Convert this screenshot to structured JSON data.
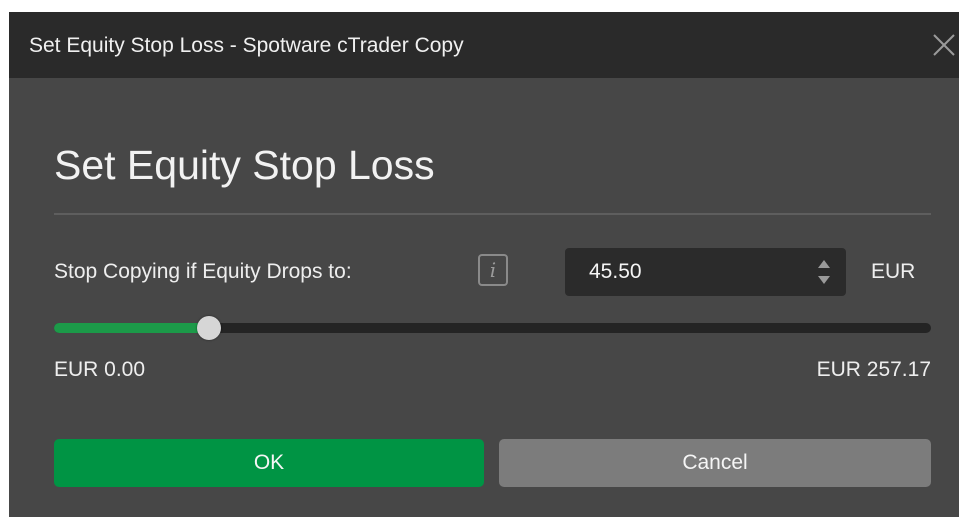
{
  "window": {
    "title": "Set Equity Stop Loss - Spotware cTrader Copy",
    "close_icon": "close-icon"
  },
  "dialog": {
    "heading": "Set Equity Stop Loss",
    "field_label": "Stop Copying if Equity Drops to:",
    "info_icon_glyph": "i",
    "info_icon": "info-icon",
    "value": "45.50",
    "unit": "EUR",
    "slider": {
      "min": 0.0,
      "max": 257.17,
      "value": 45.5
    },
    "range_min_label": "EUR 0.00",
    "range_max_label": "EUR 257.17"
  },
  "buttons": {
    "ok_label": "OK",
    "cancel_label": "Cancel"
  },
  "colors": {
    "accent_green": "#009444",
    "slider_fill": "#1c9a49",
    "panel_bg": "#474747",
    "titlebar_bg": "#2a2a2a",
    "cancel_bg": "#7c7c7c"
  }
}
